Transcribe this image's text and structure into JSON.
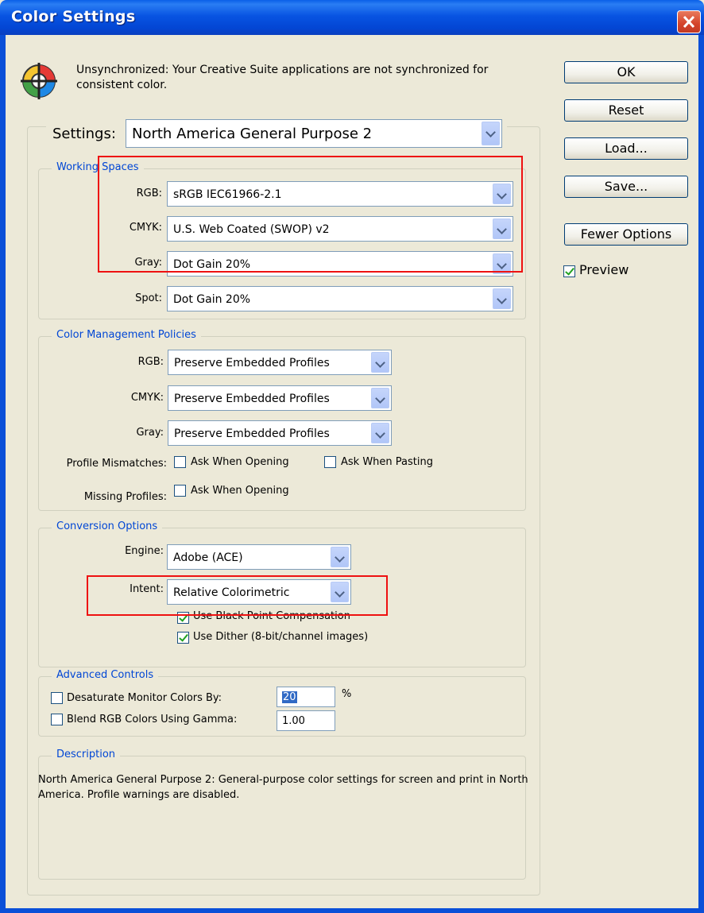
{
  "window": {
    "title": "Color Settings"
  },
  "sync_message": "Unsynchronized: Your Creative Suite applications are not synchronized for consistent color.",
  "buttons": {
    "ok": "OK",
    "reset": "Reset",
    "load": "Load...",
    "save": "Save...",
    "fewer_options": "Fewer Options"
  },
  "preview": {
    "label": "Preview",
    "checked": true
  },
  "settings": {
    "label": "Settings:",
    "value": "North America General Purpose 2"
  },
  "working_spaces": {
    "title": "Working Spaces",
    "rgb": {
      "label": "RGB:",
      "value": "sRGB IEC61966-2.1"
    },
    "cmyk": {
      "label": "CMYK:",
      "value": "U.S. Web Coated (SWOP) v2"
    },
    "gray": {
      "label": "Gray:",
      "value": "Dot Gain 20%"
    },
    "spot": {
      "label": "Spot:",
      "value": "Dot Gain 20%"
    }
  },
  "policies": {
    "title": "Color Management Policies",
    "rgb": {
      "label": "RGB:",
      "value": "Preserve Embedded Profiles"
    },
    "cmyk": {
      "label": "CMYK:",
      "value": "Preserve Embedded Profiles"
    },
    "gray": {
      "label": "Gray:",
      "value": "Preserve Embedded Profiles"
    },
    "profile_mismatches_label": "Profile Mismatches:",
    "ask_when_opening": "Ask When Opening",
    "ask_when_pasting": "Ask When Pasting",
    "missing_profiles_label": "Missing Profiles:",
    "missing_ask_when_opening": "Ask When Opening"
  },
  "conversion": {
    "title": "Conversion Options",
    "engine": {
      "label": "Engine:",
      "value": "Adobe (ACE)"
    },
    "intent": {
      "label": "Intent:",
      "value": "Relative Colorimetric"
    },
    "black_point": "Use Black Point Compensation",
    "dither": "Use Dither (8-bit/channel images)"
  },
  "advanced": {
    "title": "Advanced Controls",
    "desaturate": {
      "label": "Desaturate Monitor Colors By:",
      "value": "20",
      "unit": "%"
    },
    "blend": {
      "label": "Blend RGB Colors Using Gamma:",
      "value": "1.00"
    }
  },
  "description": {
    "title": "Description",
    "text": "North America General Purpose 2:  General-purpose color settings for screen and print in North America. Profile warnings are disabled."
  },
  "colors": {
    "title_bar": "#0a5fe8",
    "dialog_bg": "#ece9d8",
    "group_label": "#0046d5",
    "highlight": "#ee1111"
  }
}
